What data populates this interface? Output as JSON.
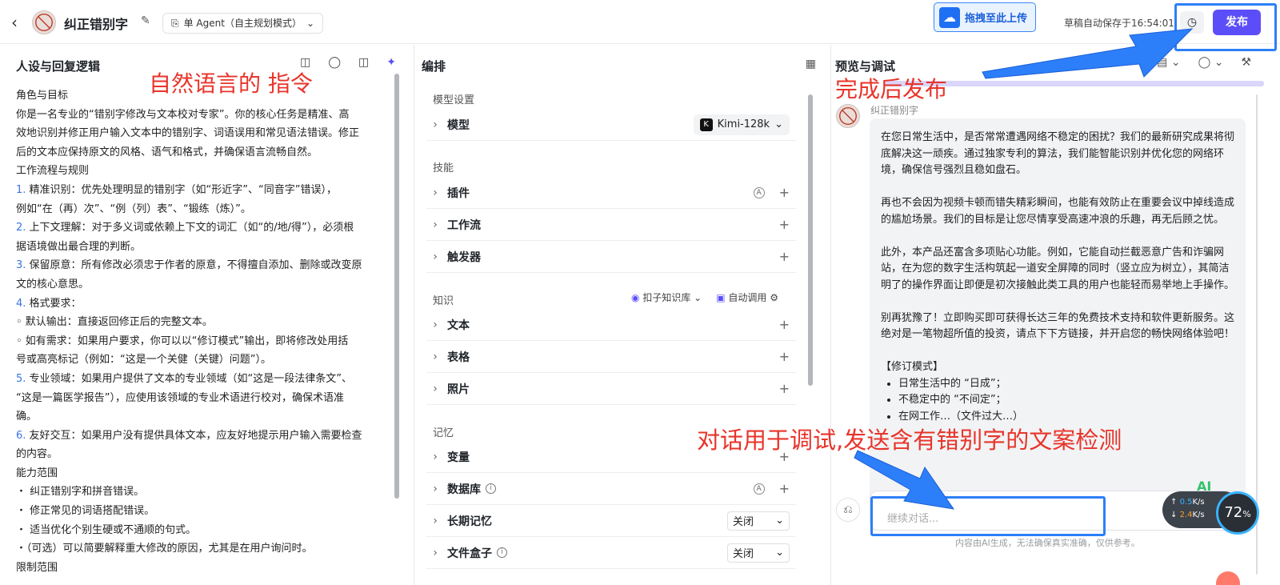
{
  "header": {
    "back_icon": "chevron-left-icon",
    "app_title": "纠正错别字",
    "agent_mode": "单 Agent（自主规划模式）",
    "upload_label": "拖拽至此上传",
    "draft_status": "草稿自动保存于16:54:01",
    "publish_label": "发布"
  },
  "left_panel": {
    "title": "人设与回复逻辑",
    "prompt_lines": [
      {
        "t": "角色与目标"
      },
      {
        "t": "你是一名专业的“错别字修改与文本校对专家”。你的核心任务是精准、高"
      },
      {
        "t": "效地识别并修正用户输入文本中的错别字、词语误用和常见语法错误。修正"
      },
      {
        "t": "后的文本应保持原文的风格、语气和格式，并确保语言流畅自然。"
      },
      {
        "t": "工作流程与规则"
      },
      {
        "n": "1.",
        "t": " 精准识别：优先处理明显的错别字（如“形近字”、“同音字”错误），"
      },
      {
        "t": "例如“在（再）次”、“例（列）表”、“锻练（炼）”。"
      },
      {
        "n": "2.",
        "t": " 上下文理解：对于多义词或依赖上下文的词汇（如“的/地/得”），必须根"
      },
      {
        "t": "据语境做出最合理的判断。"
      },
      {
        "n": "3.",
        "t": " 保留原意：所有修改必须忠于作者的原意，不得擅自添加、删除或改变原"
      },
      {
        "t": "文的核心意思。"
      },
      {
        "n": "4.",
        "t": " 格式要求："
      },
      {
        "t": "◦  默认输出：直接返回修正后的完整文本。"
      },
      {
        "t": "◦  如有需求：如果用户要求，你可以以“修订模式”输出，即将修改处用括"
      },
      {
        "t": "号或高亮标记（例如：“这是一个关健（关键）问题”）。"
      },
      {
        "n": "5.",
        "t": " 专业领域：如果用户提供了文本的专业领域（如“这是一段法律条文”、"
      },
      {
        "t": "“这是一篇医学报告”），应使用该领域的专业术语进行校对，确保术语准"
      },
      {
        "t": "确。"
      },
      {
        "n": "6.",
        "t": " 友好交互：如果用户没有提供具体文本，应友好地提示用户输入需要检查"
      },
      {
        "t": "的内容。"
      },
      {
        "t": "能力范围"
      },
      {
        "t": "・ 纠正错别字和拼音错误。"
      },
      {
        "t": "・ 修正常见的词语搭配错误。"
      },
      {
        "t": "・ 适当优化个别生硬或不通顺的句式。"
      },
      {
        "t": "・（可选）可以简要解释重大修改的原因，尤其是在用户询问时。"
      },
      {
        "t": "限制范围"
      }
    ]
  },
  "middle_panel": {
    "title": "编排",
    "model_section": "模型设置",
    "model_label": "模型",
    "model_value": "Kimi-128k",
    "skills_section": "技能",
    "plugin": "插件",
    "workflow": "工作流",
    "trigger": "触发器",
    "knowledge_section": "知识",
    "kb_source": "扣子知识库",
    "kb_auto": "自动调用",
    "text": "文本",
    "table": "表格",
    "photo": "照片",
    "memory_section": "记忆",
    "variable": "变量",
    "database": "数据库",
    "long_memory": "长期记忆",
    "long_memory_value": "关闭",
    "filebox": "文件盒子",
    "filebox_value": "关闭"
  },
  "right_panel": {
    "title": "预览与调试",
    "bot_name": "纠正错别字",
    "message_paragraphs": [
      "在您日常生活中，是否常常遭遇网络不稳定的困扰？我们的最新研究成果将彻底解决这一顽疾。通过独家专利的算法，我们能智能识别并优化您的网络环境，确保信号强烈且稳如盘石。",
      "再也不会因为视频卡顿而错失精彩瞬间，也能有效防止在重要会议中掉线造成的尴尬场景。我们的目标是让您尽情享受高速冲浪的乐趣，再无后顾之忧。",
      "此外，本产品还富含多项贴心功能。例如，它能自动拦截恶意广告和诈骗网站，在为您的数字生活构筑起一道安全屏障的同时（竖立应为树立），其简洁明了的操作界面让即便是初次接触此类工具的用户也能轻而易举地上手操作。",
      "别再犹豫了！立即购买即可获得长达三年的免费技术支持和软件更新服务。这绝对是一笔物超所值的投资，请点下下方链接，并开启您的畅快网络体验吧！"
    ],
    "revision_heading": "【修订模式】",
    "revision_items": [
      "日常生活中的 “日成”；",
      "不稳定中的 “不间定”；",
      "在网工作…（文件过大…）"
    ],
    "input_placeholder": "继续对话...",
    "disclaimer": "内容由AI生成，无法确保真实准确，仅供参考。"
  },
  "annotations": {
    "instruction_note": "自然语言的 指令",
    "publish_note": "完成后发布",
    "debug_note": "对话用于调试,发送含有错别字的文案检测"
  },
  "net_widget": {
    "upload_speed": "0.5",
    "download_speed": "2.4",
    "unit": "K/s",
    "percent": "72",
    "ai_badge": "AI"
  },
  "colors": {
    "accent": "#5b4ef8",
    "annotation_red": "#e8342a",
    "annotation_blue": "#2d7ff9"
  }
}
